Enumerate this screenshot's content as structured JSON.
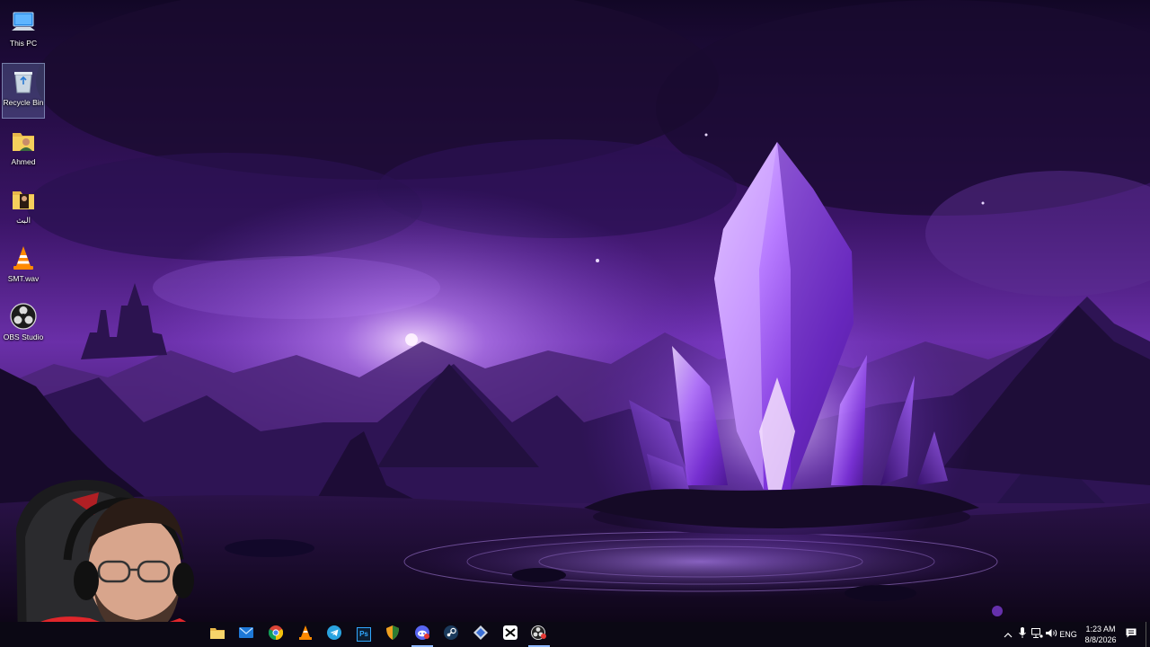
{
  "desktop": {
    "icons": [
      {
        "label": "This PC",
        "icon": "this-pc-icon"
      },
      {
        "label": "Recycle Bin",
        "icon": "recycle-bin-icon",
        "selected": true
      },
      {
        "label": "Ahmed",
        "icon": "user-folder-icon"
      },
      {
        "label": "البث",
        "icon": "folder-icon"
      },
      {
        "label": "SMT.wav",
        "icon": "vlc-cone-icon"
      },
      {
        "label": "OBS Studio",
        "icon": "obs-studio-icon"
      }
    ]
  },
  "taskbar": {
    "apps": [
      {
        "name": "file-explorer",
        "icon": "folder-icon"
      },
      {
        "name": "mail",
        "icon": "mail-icon"
      },
      {
        "name": "chrome",
        "icon": "chrome-icon"
      },
      {
        "name": "vlc",
        "icon": "vlc-cone-icon"
      },
      {
        "name": "telegram",
        "icon": "telegram-icon"
      },
      {
        "name": "photoshop",
        "icon": "photoshop-icon",
        "text": "Ps"
      },
      {
        "name": "shield-app",
        "icon": "shield-icon"
      },
      {
        "name": "discord",
        "icon": "discord-icon",
        "active": true
      },
      {
        "name": "steam",
        "icon": "steam-icon"
      },
      {
        "name": "network-app",
        "icon": "network-diamond-icon"
      },
      {
        "name": "capcut",
        "icon": "capcut-icon"
      },
      {
        "name": "obs-studio",
        "icon": "obs-studio-icon",
        "active": true
      }
    ],
    "tray": {
      "language": "ENG",
      "time": "1:23 AM",
      "date": "8/8/2026"
    }
  },
  "colors": {
    "taskbar_bg": "#0b0814",
    "accent": "#8fb7ff",
    "crystal": "#a45cff"
  }
}
